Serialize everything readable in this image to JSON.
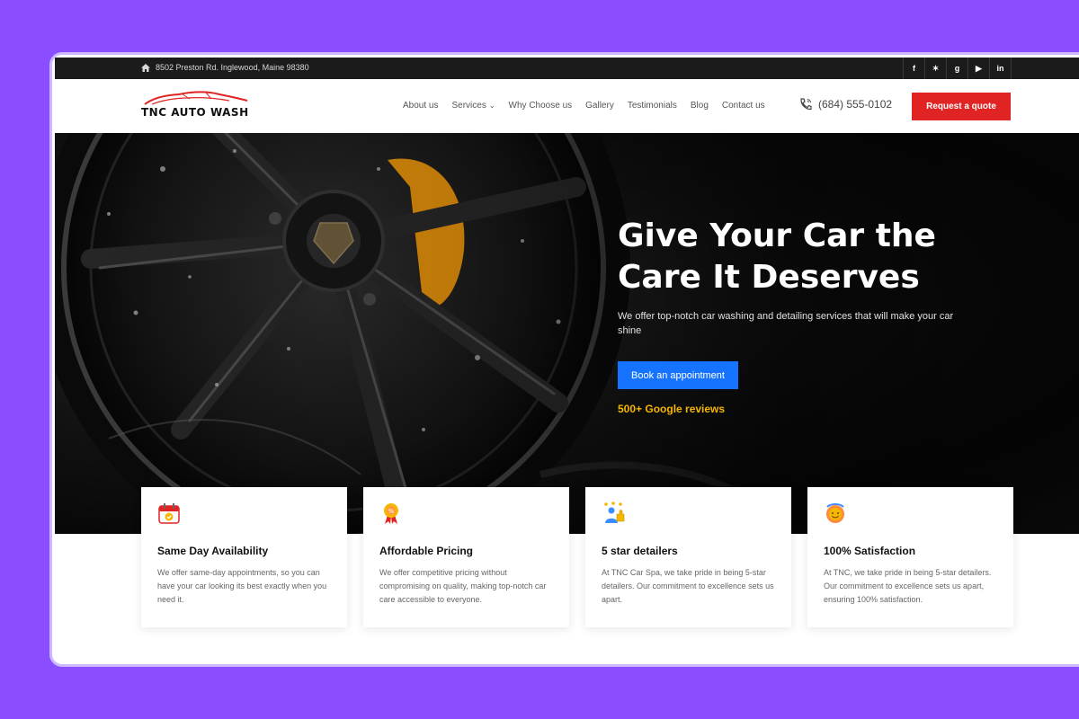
{
  "topbar": {
    "address": "8502 Preston Rd. Inglewood, Maine 98380",
    "socials": [
      {
        "icon": "facebook-icon",
        "glyph": "f"
      },
      {
        "icon": "twitter-icon",
        "glyph": "✶"
      },
      {
        "icon": "google-icon",
        "glyph": "g"
      },
      {
        "icon": "youtube-icon",
        "glyph": "▶"
      },
      {
        "icon": "linkedin-icon",
        "glyph": "in"
      }
    ]
  },
  "header": {
    "logo_text": "TNC AUTO WASH",
    "nav": [
      "About us",
      "Services",
      "Why Choose us",
      "Gallery",
      "Testimonials",
      "Blog",
      "Contact us"
    ],
    "phone": "(684) 555-0102",
    "quote_label": "Request a quote"
  },
  "hero": {
    "title": "Give Your Car the Care It Deserves",
    "subtitle": "We offer top-notch car washing and detailing services that will make your car shine",
    "cta_label": "Book an appointment",
    "reviews": "500+ Google reviews"
  },
  "features": [
    {
      "icon": "calendar-icon",
      "title": "Same Day Availability",
      "text": "We offer same-day appointments, so you can have your car looking its best exactly when you need it."
    },
    {
      "icon": "badge-icon",
      "title": "Affordable Pricing",
      "text": "We offer competitive pricing without compromising on quality, making top-notch car care accessible to everyone."
    },
    {
      "icon": "thumbs-up-icon",
      "title": "5 star detailers",
      "text": "At TNC Car Spa, we take pride in being 5-star detailers. Our commitment to excellence sets us apart."
    },
    {
      "icon": "satisfaction-icon",
      "title": "100% Satisfaction",
      "text": "At TNC, we take pride in being 5-star detailers. Our commitment to excellence sets us apart, ensuring 100% satisfaction."
    }
  ],
  "colors": {
    "background": "#8a4dff",
    "quote_button": "#e02424",
    "cta_button": "#1673ff",
    "reviews": "#f5b700"
  }
}
